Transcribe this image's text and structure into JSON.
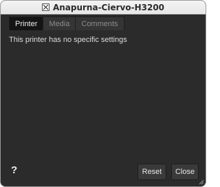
{
  "window": {
    "title": "Anapurna-Ciervo-H3200",
    "title_icon": "x11-icon"
  },
  "tabs": [
    {
      "label": "Printer",
      "active": true
    },
    {
      "label": "Media",
      "active": false
    },
    {
      "label": "Comments",
      "active": false
    }
  ],
  "content": {
    "message": "This printer has no specific settings"
  },
  "footer": {
    "help_label": "?",
    "reset_label": "Reset",
    "close_label": "Close"
  },
  "colors": {
    "background": "#2b2b2b",
    "active_tab": "#141414",
    "text": "#dddddd"
  }
}
